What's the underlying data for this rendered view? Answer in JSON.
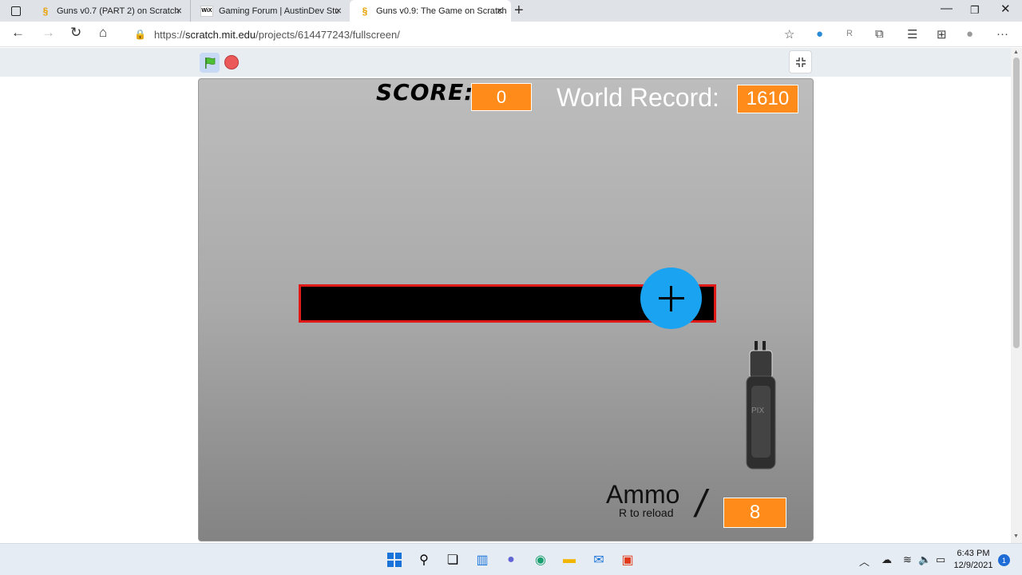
{
  "browser": {
    "tabs": [
      {
        "title": "Guns v0.7 (PART 2) on Scratch",
        "favicon": "scratch-icon"
      },
      {
        "title": "Gaming Forum | AustinDev Studio",
        "favicon": "wix-icon"
      },
      {
        "title": "Guns v0.9: The Game on Scratch",
        "favicon": "scratch-icon",
        "active": true
      }
    ],
    "url_prefix": "https://",
    "url_host": "scratch.mit.edu",
    "url_path": "/projects/614477243/fullscreen/",
    "wix_label": "WiX",
    "ext_r_label": "R"
  },
  "game": {
    "score_label": "SCORE:",
    "score_value": "0",
    "world_record_label": "World Record:",
    "world_record_value": "1610",
    "ammo_label": "Ammo",
    "reload_hint": "R to reload",
    "slash": "/",
    "ammo_value": "8",
    "gun_watermark": "PIX",
    "colors": {
      "orange": "#ff8c1a",
      "plus": "#1aa3f0",
      "bar_border": "#e01818"
    }
  },
  "taskbar": {
    "time": "6:43 PM",
    "date": "12/9/2021",
    "notifications": "1"
  }
}
